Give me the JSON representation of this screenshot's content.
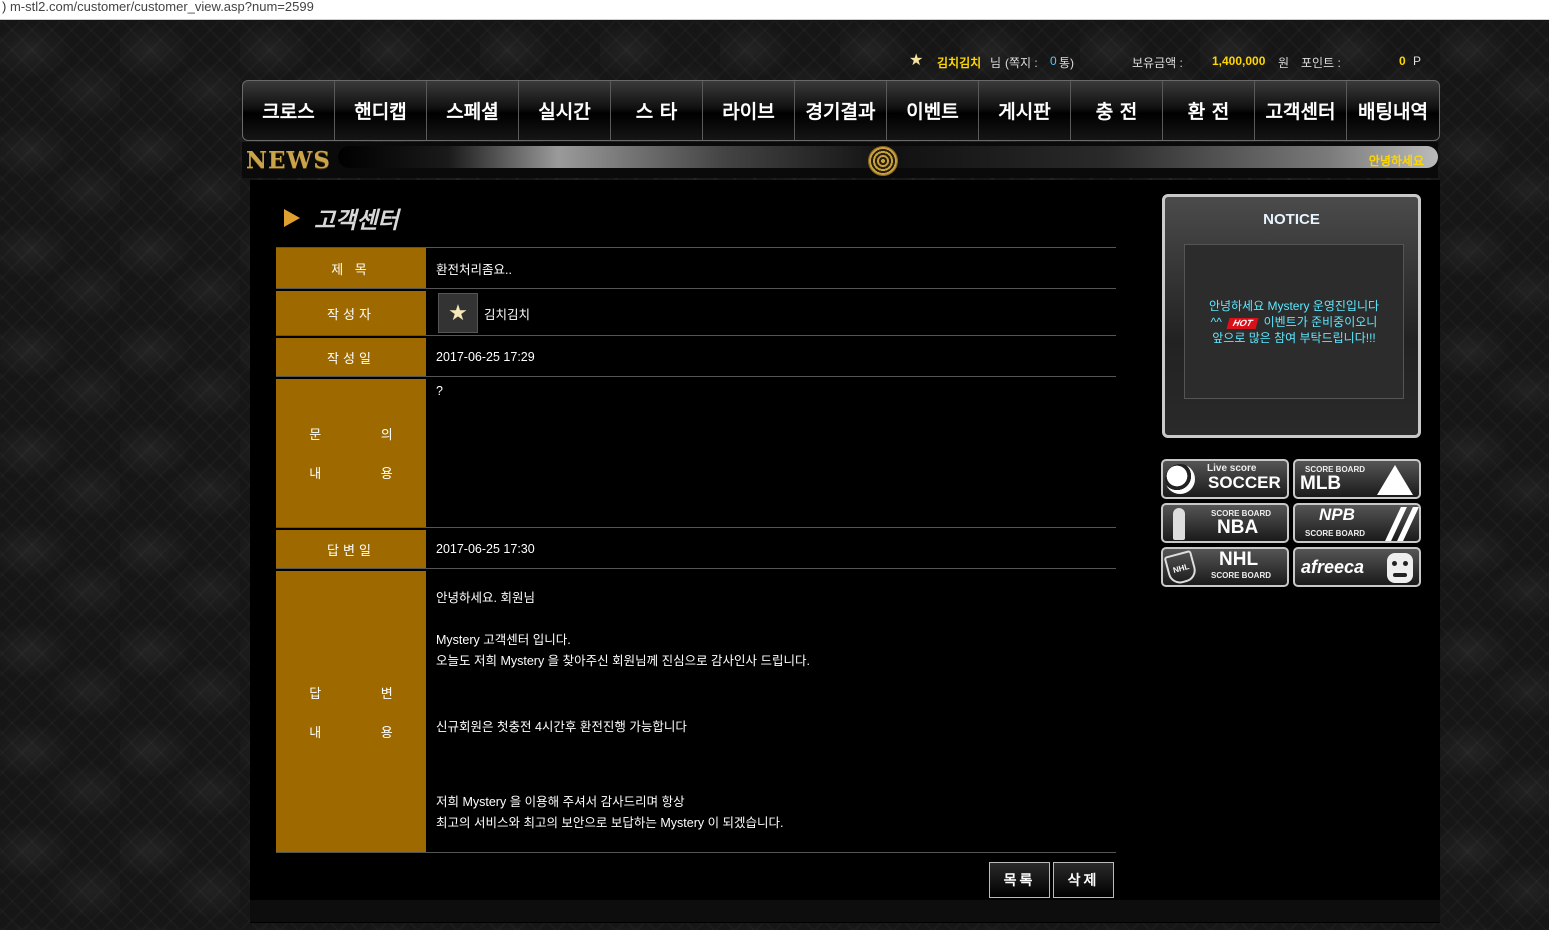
{
  "browser": {
    "url": "m-stl2.com/customer/customer_view.asp?num=2599",
    "url_prefix": ")"
  },
  "userbar": {
    "username": "김치김치",
    "honorific": "님",
    "msg_prefix": "(쪽지 :",
    "msg_count": "0",
    "msg_suffix": "통)",
    "balance_label": "보유금액 :",
    "balance_value": "1,400,000",
    "balance_unit": "원",
    "points_label": "포인트 :",
    "points_value": "0",
    "points_unit": "P"
  },
  "nav": [
    "크로스",
    "핸디캡",
    "스페셜",
    "실시간",
    "스 타",
    "라이브",
    "경기결과",
    "이벤트",
    "게시판",
    "충 전",
    "환 전",
    "고객센터",
    "배팅내역"
  ],
  "news": {
    "title": "NEWS",
    "ticker": "안녕하세요"
  },
  "page": {
    "title": "고객센터"
  },
  "post": {
    "subject_label": "제 목",
    "subject": "환전처리좀요..",
    "author_label": "작성자",
    "author": "김치김치",
    "date_label": "작성일",
    "date": "2017-06-25 17:29",
    "inquiry_label_1": "문 의",
    "inquiry_label_2": "내 용",
    "inquiry": "?",
    "answer_date_label": "답변일",
    "answer_date": "2017-06-25 17:30",
    "answer_label_1": "답 변",
    "answer_label_2": "내 용",
    "answer_lines": [
      "안녕하세요. 회원님",
      "",
      "Mystery 고객센터 입니다.",
      "오늘도 저희 Mystery 을 찾아주신 회원님께 진심으로 감사인사 드립니다.",
      "",
      "",
      "신규회원은 첫충전 4시간후 환전진행 가능합니다",
      "",
      "",
      "",
      "저희 Mystery 을 이용해 주셔서 감사드리며 항상",
      "최고의 서비스와 최고의 보안으로 보답하는 Mystery 이 되겠습니다."
    ]
  },
  "buttons": {
    "list": "목록",
    "delete": "삭제"
  },
  "notice": {
    "title": "NOTICE",
    "line1": "안녕하세요 Mystery 운영진입니다",
    "line2_pre": "^^",
    "hot": "HOT",
    "line2_post": "이벤트가 준비중이오니",
    "line3": "앞으로 많은 참여 부탁드립니다!!!"
  },
  "scoreboards": {
    "soccer": {
      "small": "Live score",
      "big": "SOCCER"
    },
    "mlb": {
      "small": "SCORE BOARD",
      "big": "MLB"
    },
    "nba": {
      "small": "SCORE BOARD",
      "big": "NBA"
    },
    "npb": {
      "small": "SCORE BOARD",
      "big": "NPB"
    },
    "nhl": {
      "small": "SCORE BOARD",
      "big": "NHL",
      "logo": "NHL"
    },
    "afreeca": {
      "big": "afreeca"
    }
  },
  "colors": {
    "gold_label": "#9e6a00",
    "accent_yellow": "#ffd700",
    "notice_text": "#5ee8ff"
  }
}
